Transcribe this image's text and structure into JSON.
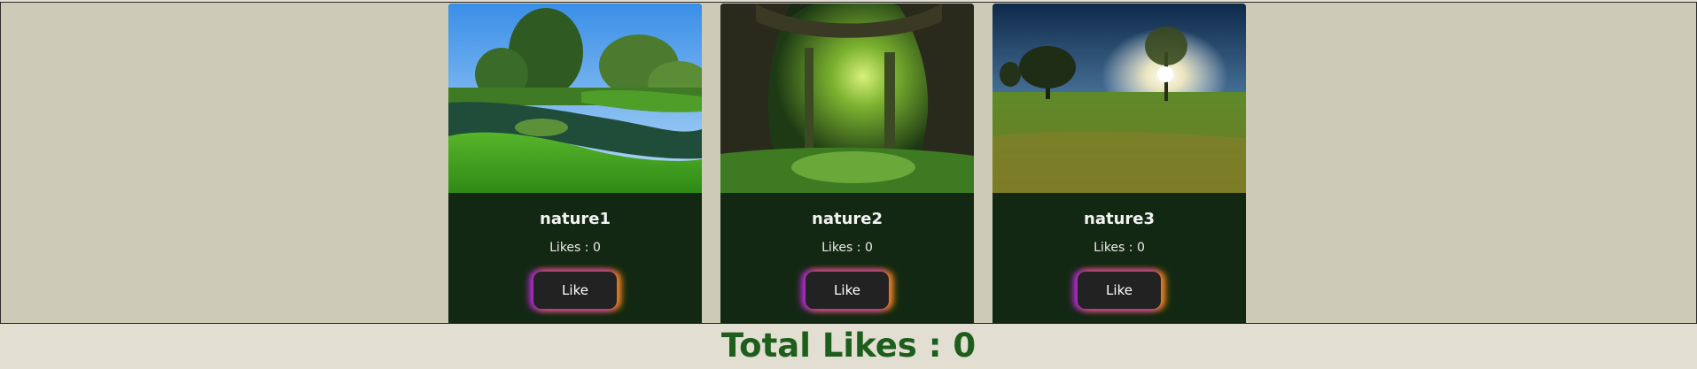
{
  "cards": [
    {
      "title": "nature1",
      "likes_label": "Likes : 0",
      "button_label": "Like",
      "image": "nature-lake-landscape"
    },
    {
      "title": "nature2",
      "likes_label": "Likes : 0",
      "button_label": "Like",
      "image": "forest-tunnel"
    },
    {
      "title": "nature3",
      "likes_label": "Likes : 0",
      "button_label": "Like",
      "image": "meadow-sunset-tree"
    }
  ],
  "total_likes_label": "Total Likes : 0",
  "colors": {
    "page_background": "#e2dfd2",
    "gallery_background": "#cbcbb7",
    "card_background": "#132812",
    "button_background": "#222222",
    "total_text": "#1d5e1c"
  }
}
